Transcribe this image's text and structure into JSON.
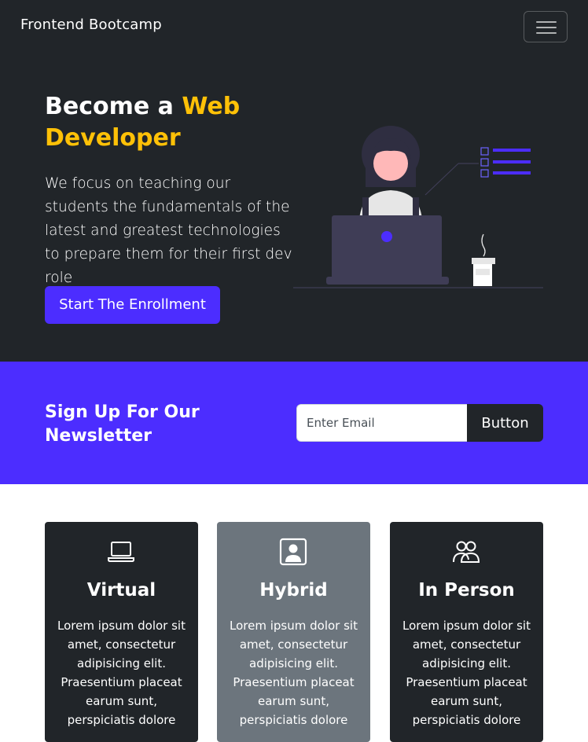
{
  "navbar": {
    "brand": "Frontend Bootcamp",
    "toggler_icon": "hamburger-menu-icon"
  },
  "hero": {
    "title_prefix": "Become a ",
    "title_accent": "Web Developer",
    "lead": "We focus on teaching our students the fundamentals of the latest and greatest technologies to prepare them for their first dev role",
    "cta_label": "Start The Enrollment",
    "illustration": "woman-at-laptop-illustration"
  },
  "newsletter": {
    "title": "Sign Up For Our Newsletter",
    "email_placeholder": "Enter Email",
    "email_value": "",
    "button_label": "Button"
  },
  "cards": [
    {
      "icon": "laptop-icon",
      "title": "Virtual",
      "text": "Lorem ipsum dolor sit amet, consectetur adipisicing elit. Praesentium placeat earum sunt, perspiciatis dolore"
    },
    {
      "icon": "person-badge-icon",
      "title": "Hybrid",
      "text": "Lorem ipsum dolor sit amet, consectetur adipisicing elit. Praesentium placeat earum sunt, perspiciatis dolore"
    },
    {
      "icon": "people-icon",
      "title": "In Person",
      "text": "Lorem ipsum dolor sit amet, consectetur adipisicing elit. Praesentium placeat earum sunt, perspiciatis dolore"
    }
  ],
  "colors": {
    "dark": "#212529",
    "primary": "#4c2dff",
    "accent": "#ffc107",
    "secondary": "#6c757d"
  }
}
